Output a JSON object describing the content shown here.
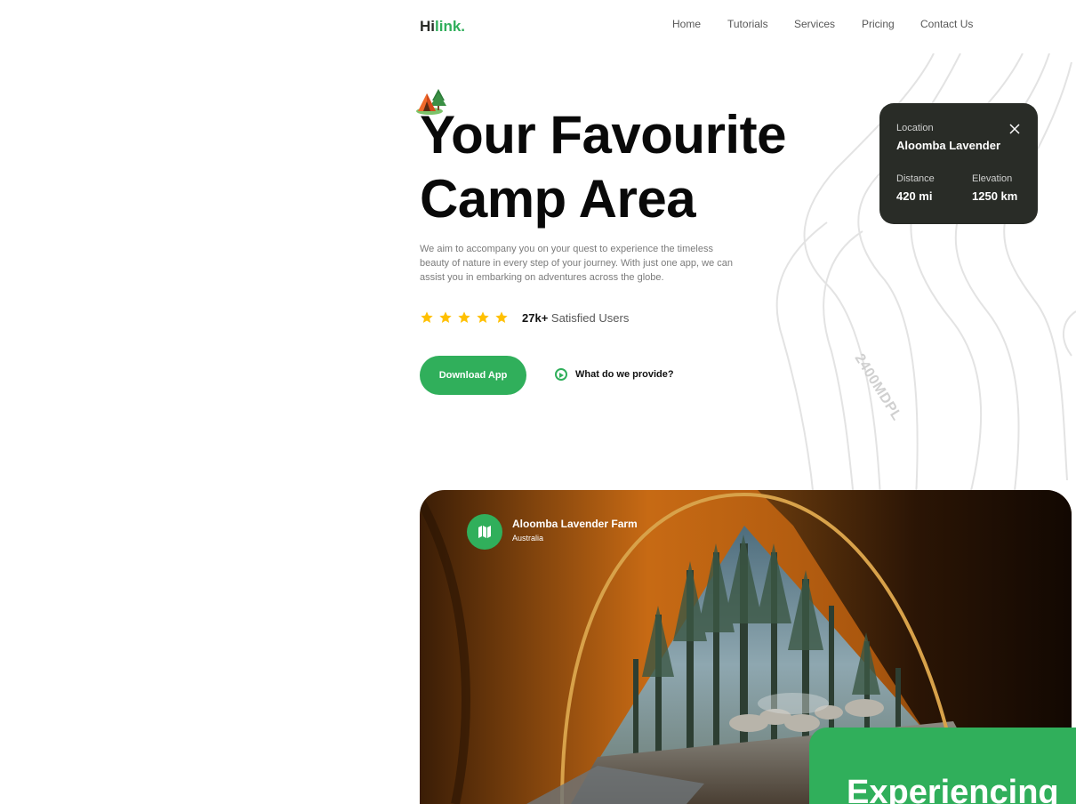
{
  "brand": {
    "prefix": "Hi",
    "accent": "link.",
    "accent_color": "#30af5b"
  },
  "nav": {
    "items": [
      "Home",
      "Tutorials",
      "Services",
      "Pricing",
      "Contact Us"
    ]
  },
  "hero": {
    "title_line1": "Your Favourite",
    "title_line2": "Camp Area",
    "description": "We aim to accompany you on your quest to experience the timeless beauty of nature in every step of your journey. With just one app, we can assist you in embarking on adventures across the globe.",
    "rating_stars": 5,
    "users_count": "27k+",
    "users_label": " Satisfied Users",
    "download_label": "Download App",
    "provide_label": "What do we provide?"
  },
  "location_card": {
    "location_label": "Location",
    "location_value": "Aloomba Lavender",
    "distance_label": "Distance",
    "distance_value": "420 mi",
    "elevation_label": "Elevation",
    "elevation_value": "1250 km"
  },
  "topo_label": "2400MDPL",
  "feature": {
    "place_title": "Aloomba Lavender Farm",
    "place_subtitle": "Australia",
    "heading": "Experiencing"
  },
  "colors": {
    "primary": "#30af5b",
    "dark": "#292c27",
    "star": "#ffc000"
  },
  "icons": [
    "camp-tent-icon",
    "star-icon",
    "play-icon",
    "close-icon",
    "map-icon"
  ]
}
